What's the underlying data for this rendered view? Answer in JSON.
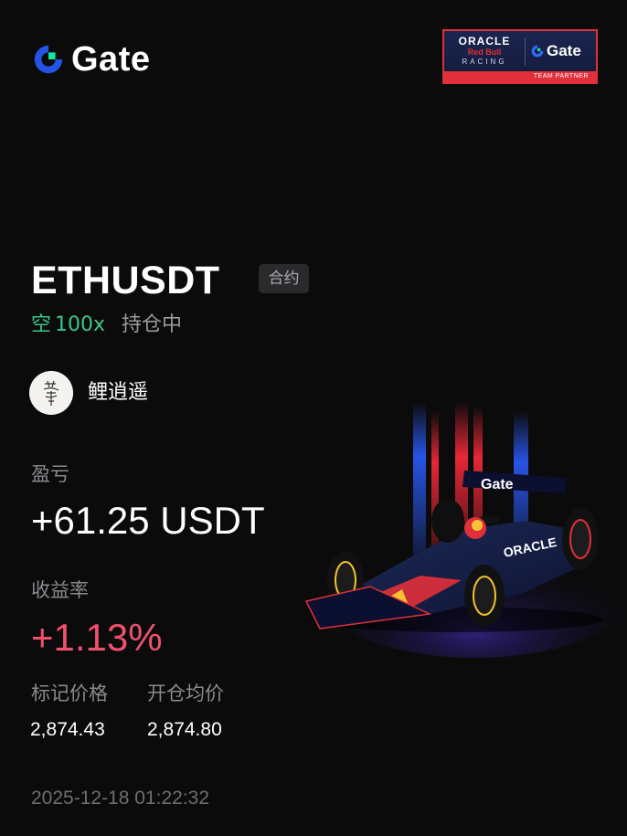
{
  "brand": {
    "name": "Gate"
  },
  "partner": {
    "oracle": "ORACLE",
    "redbull": "Red Bull",
    "racing": "RACING",
    "gate": "Gate",
    "footer": "TEAM PARTNER"
  },
  "position": {
    "pair": "ETHUSDT",
    "type_tag": "合约",
    "side": "空",
    "leverage": "100x",
    "status": "持仓中"
  },
  "user": {
    "name": "鲤逍遥"
  },
  "stats": {
    "pnl_label": "盈亏",
    "pnl_value": "+61.25 USDT",
    "roe_label": "收益率",
    "roe_value": "+1.13%",
    "mark_price_label": "标记价格",
    "mark_price_value": "2,874.43",
    "entry_price_label": "开仓均价",
    "entry_price_value": "2,874.80"
  },
  "timestamp": "2025-12-18 01:22:32",
  "car_livery_text": {
    "nose_brand": "Gate",
    "sidepod_brand": "ORACLE"
  },
  "colors": {
    "background": "#0b0b0b",
    "short_green": "#3cc68a",
    "profit_red": "#f0506e",
    "gate_blue": "#2354e6",
    "gate_green": "#17e5a0",
    "partner_red": "#e0303b",
    "partner_navy": "#1a2345"
  },
  "icons": {
    "brand_logo": "gate-logo-icon",
    "avatar": "user-avatar-icon",
    "car": "red-bull-f1-car-image"
  }
}
